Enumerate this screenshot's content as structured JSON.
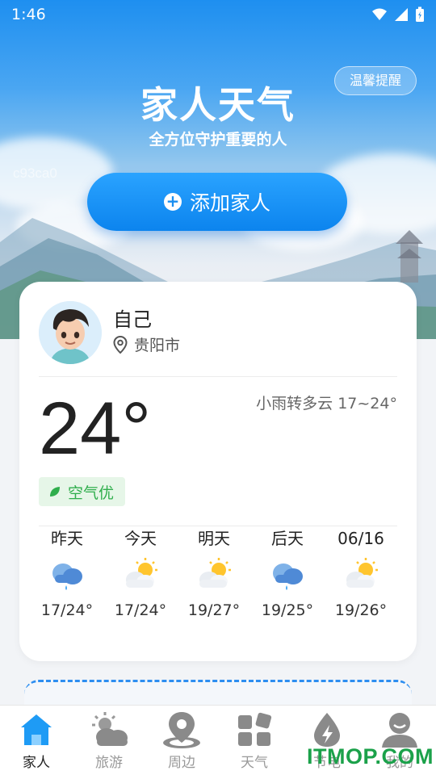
{
  "status_bar": {
    "time": "1:46",
    "icons": [
      "wifi-icon",
      "signal-icon",
      "battery-icon"
    ]
  },
  "header": {
    "tip_button": "温馨提醒",
    "title": "家人天气",
    "subtitle": "全方位守护重要的人",
    "watermark": "c93ca0",
    "add_button": "添加家人"
  },
  "card": {
    "name": "自己",
    "location": "贵阳市",
    "condition": "小雨转多云 17~24°",
    "temperature": "24°",
    "air_quality": "空气优",
    "forecast": [
      {
        "label": "昨天",
        "icon": "rain-cloud-icon",
        "range": "17/24°"
      },
      {
        "label": "今天",
        "icon": "partly-cloudy-icon",
        "range": "17/24°"
      },
      {
        "label": "明天",
        "icon": "partly-cloudy-icon",
        "range": "19/27°"
      },
      {
        "label": "后天",
        "icon": "rain-cloud-icon",
        "range": "19/25°"
      },
      {
        "label": "06/16",
        "icon": "partly-cloudy-icon",
        "range": "19/26°"
      }
    ]
  },
  "tabs": [
    {
      "label": "家人",
      "icon": "home-icon",
      "active": true
    },
    {
      "label": "旅游",
      "icon": "travel-weather-icon",
      "active": false
    },
    {
      "label": "周边",
      "icon": "location-pin-icon",
      "active": false
    },
    {
      "label": "天气",
      "icon": "grid-icon",
      "active": false
    },
    {
      "label": "节电",
      "icon": "power-drop-icon",
      "active": false
    },
    {
      "label": "我的",
      "icon": "profile-icon",
      "active": false
    }
  ],
  "brand_watermark": "ITMOP.COM",
  "colors": {
    "primary": "#0c84ee",
    "aqi_green": "#2fae4c",
    "brand_green": "#1ba14a"
  }
}
